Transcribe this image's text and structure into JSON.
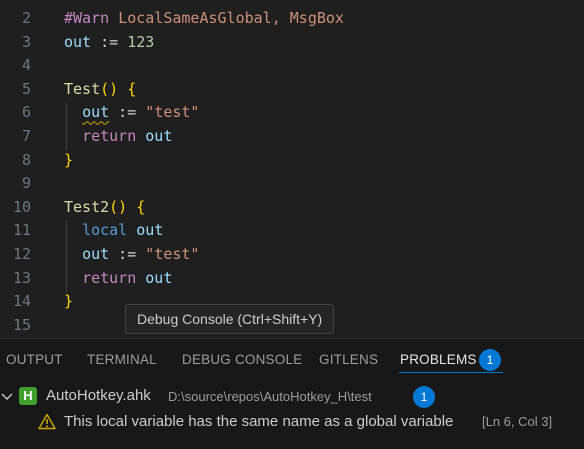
{
  "editor": {
    "lines": [
      {
        "num": "2",
        "tokens": [
          {
            "t": "#Warn ",
            "c": "t-dir"
          },
          {
            "t": "LocalSameAsGlobal, MsgBox",
            "c": "t-str"
          }
        ]
      },
      {
        "num": "3",
        "tokens": [
          {
            "t": "out",
            "c": "t-var"
          },
          {
            "t": " := ",
            "c": "t-op"
          },
          {
            "t": "123",
            "c": "t-num"
          }
        ]
      },
      {
        "num": "4",
        "tokens": []
      },
      {
        "num": "5",
        "tokens": [
          {
            "t": "Test",
            "c": "t-fn"
          },
          {
            "t": "() {",
            "c": "t-br"
          }
        ]
      },
      {
        "num": "6",
        "tokens": [
          {
            "t": "  ",
            "c": "t-op"
          },
          {
            "t": "out",
            "c": "t-var squiggle"
          },
          {
            "t": " := ",
            "c": "t-op"
          },
          {
            "t": "\"test\"",
            "c": "t-str"
          }
        ]
      },
      {
        "num": "7",
        "tokens": [
          {
            "t": "  ",
            "c": "t-op"
          },
          {
            "t": "return",
            "c": "t-kw-flow"
          },
          {
            "t": " ",
            "c": "t-op"
          },
          {
            "t": "out",
            "c": "t-var"
          }
        ]
      },
      {
        "num": "8",
        "tokens": [
          {
            "t": "}",
            "c": "t-br"
          }
        ]
      },
      {
        "num": "9",
        "tokens": []
      },
      {
        "num": "10",
        "tokens": [
          {
            "t": "Test2",
            "c": "t-fn"
          },
          {
            "t": "() {",
            "c": "t-br"
          }
        ]
      },
      {
        "num": "11",
        "tokens": [
          {
            "t": "  ",
            "c": "t-op"
          },
          {
            "t": "local",
            "c": "t-kw-decl"
          },
          {
            "t": " ",
            "c": "t-op"
          },
          {
            "t": "out",
            "c": "t-var"
          }
        ]
      },
      {
        "num": "12",
        "tokens": [
          {
            "t": "  ",
            "c": "t-op"
          },
          {
            "t": "out",
            "c": "t-var"
          },
          {
            "t": " := ",
            "c": "t-op"
          },
          {
            "t": "\"test\"",
            "c": "t-str"
          }
        ]
      },
      {
        "num": "13",
        "tokens": [
          {
            "t": "  ",
            "c": "t-op"
          },
          {
            "t": "return",
            "c": "t-kw-flow"
          },
          {
            "t": " ",
            "c": "t-op"
          },
          {
            "t": "out",
            "c": "t-var"
          }
        ]
      },
      {
        "num": "14",
        "tokens": [
          {
            "t": "}",
            "c": "t-br"
          }
        ]
      },
      {
        "num": "15",
        "tokens": []
      }
    ]
  },
  "tooltip": {
    "text": "Debug Console (Ctrl+Shift+Y)"
  },
  "panel": {
    "tabs": {
      "output": "OUTPUT",
      "terminal": "TERMINAL",
      "debug_console": "DEBUG CONSOLE",
      "gitlens": "GITLENS",
      "problems": "PROBLEMS"
    },
    "problems_count": "1",
    "file": {
      "icon_letter": "H",
      "name": "AutoHotkey.ahk",
      "path": "D:\\source\\repos\\AutoHotkey_H\\test",
      "count": "1"
    },
    "problem": {
      "message": "This local variable has the same name as a global variable",
      "location": "[Ln 6, Col 3]"
    }
  },
  "colors": {
    "accent": "#0078d4",
    "warning": "#cca700",
    "ahk_icon": "#40a02b"
  },
  "icons": {
    "chevron": "chevron-down-icon",
    "file": "ahk-file-icon",
    "warning": "warning-icon"
  }
}
